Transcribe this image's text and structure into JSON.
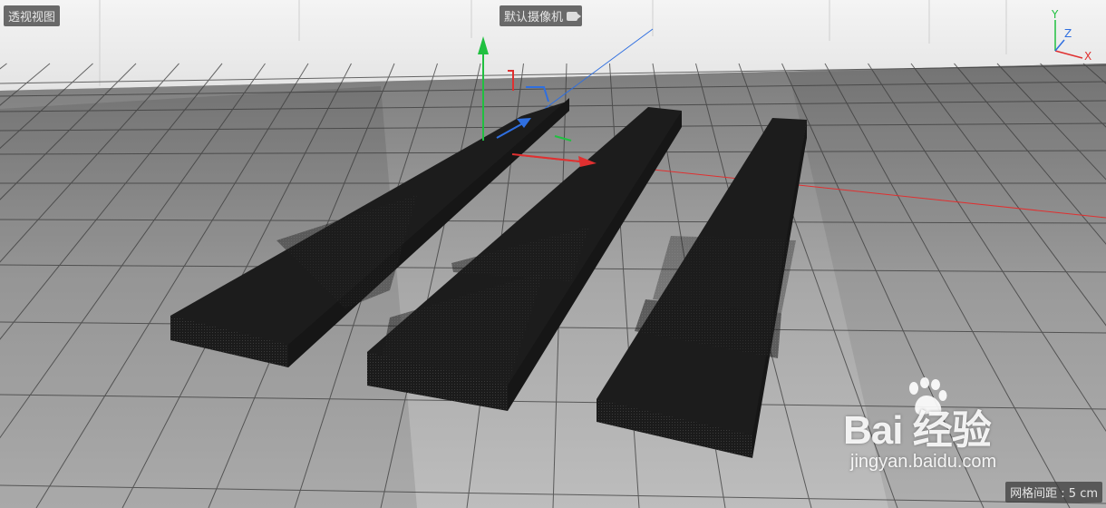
{
  "viewport": {
    "view_name": "透视视图",
    "camera_name": "默认摄像机",
    "grid_spacing": "网格间距 : 5 cm",
    "axis_labels": {
      "y": "Y",
      "z": "Z",
      "x": "X"
    }
  },
  "watermark": {
    "brand": "Bai  经验",
    "url": "jingyan.baidu.com"
  },
  "colors": {
    "background": "#9c9c9c",
    "axis_x": "#e03030",
    "axis_y": "#20c040",
    "axis_z": "#2f6fe0",
    "object": "#1e1e1e"
  },
  "icons": {
    "camera": "camera-icon",
    "axis_widget": "axis-gizmo-icon",
    "paw": "baidu-paw-icon"
  }
}
